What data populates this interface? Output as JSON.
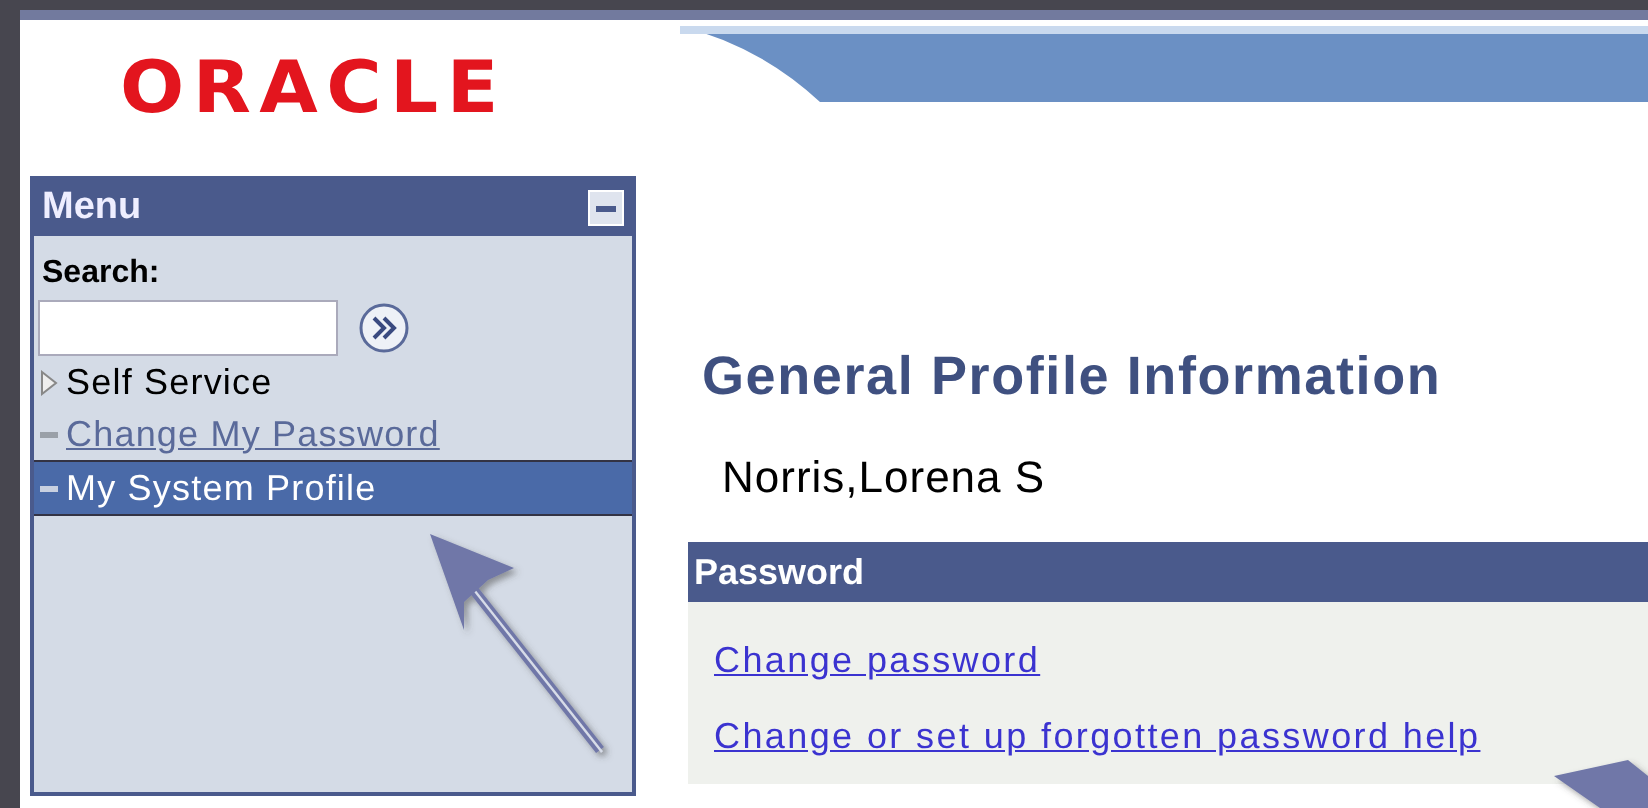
{
  "header": {
    "logo": "ORACLE"
  },
  "menu": {
    "title": "Menu",
    "search": {
      "label": "Search:"
    },
    "items": [
      {
        "label": "Self Service",
        "kind": "folder",
        "selected": false
      },
      {
        "label": "Change My Password",
        "kind": "link",
        "selected": false
      },
      {
        "label": "My System Profile",
        "kind": "link",
        "selected": true
      }
    ]
  },
  "content": {
    "title": "General Profile Information",
    "name": "Norris,Lorena S",
    "section": {
      "title": "Password",
      "links": [
        "Change password",
        "Change or set up forgotten password help"
      ]
    }
  }
}
